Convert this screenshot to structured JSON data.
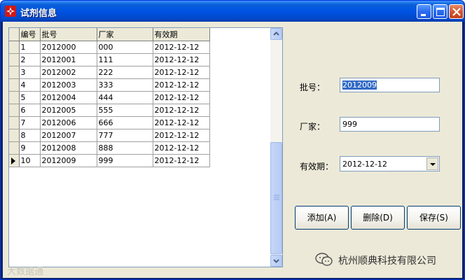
{
  "window": {
    "title": "试剂信息",
    "icon": "app-icon"
  },
  "grid": {
    "columns": [
      "编号",
      "批号",
      "厂家",
      "有效期"
    ],
    "rows": [
      [
        "1",
        "2012000",
        "000",
        "2012-12-12"
      ],
      [
        "2",
        "2012001",
        "111",
        "2012-12-12"
      ],
      [
        "3",
        "2012002",
        "222",
        "2012-12-12"
      ],
      [
        "4",
        "2012003",
        "333",
        "2012-12-12"
      ],
      [
        "5",
        "2012004",
        "444",
        "2012-12-12"
      ],
      [
        "6",
        "2012005",
        "555",
        "2012-12-12"
      ],
      [
        "7",
        "2012006",
        "666",
        "2012-12-12"
      ],
      [
        "8",
        "2012007",
        "777",
        "2012-12-12"
      ],
      [
        "9",
        "2012008",
        "888",
        "2012-12-12"
      ],
      [
        "10",
        "2012009",
        "999",
        "2012-12-12"
      ]
    ],
    "current_row_index": 9
  },
  "form": {
    "batch_label": "批号：",
    "batch_value": "2012009",
    "maker_label": "厂家：",
    "maker_value": "999",
    "expiry_label": "有效期：",
    "expiry_value": "2012-12-12"
  },
  "buttons": {
    "add_label": "添加(A)",
    "delete_label": "删除(D)",
    "save_label": "保存(S)"
  },
  "watermark": {
    "company": "杭州顺典科技有限公司",
    "left_text": "大数据通"
  },
  "colors": {
    "titlebar": "#0054e3",
    "face": "#ece9d8",
    "selection": "#316ac5",
    "border": "#7f9db9"
  }
}
